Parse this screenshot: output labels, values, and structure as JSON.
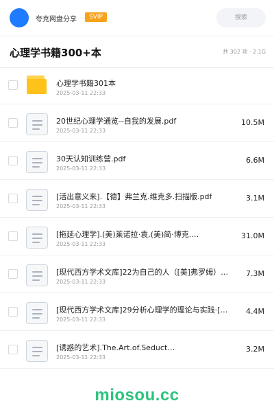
{
  "header": {
    "app_name": "夸克网盘分享",
    "badge": "SVIP",
    "search_label": "搜索"
  },
  "folder": {
    "title": "心理学书籍300+本",
    "meta": "共 302 项 · 2.1G"
  },
  "items": [
    {
      "type": "folder",
      "name": "心理学书籍301本",
      "date": "2025-03-11 22:33",
      "size": ""
    },
    {
      "type": "file",
      "name": "20世纪心理学通览--自我的发展.pdf",
      "date": "2025-03-11 22:33",
      "size": "10.5M"
    },
    {
      "type": "file",
      "name": "30天认知训练营.pdf",
      "date": "2025-03-11 22:33",
      "size": "6.6M"
    },
    {
      "type": "file",
      "name": "[活出意义来].【德】弗兰克.维克多.扫描版.pdf",
      "date": "2025-03-11 22:33",
      "size": "3.1M"
    },
    {
      "type": "file",
      "name": "[拖延心理学].(美)莱诺拉·袁,(美)简·博克.…",
      "date": "2025-03-11 22:33",
      "size": "31.0M"
    },
    {
      "type": "file",
      "name": "[现代西方学术文库]22为自己的人（[美]弗罗姆）…",
      "date": "2025-03-11 22:33",
      "size": "7.3M"
    },
    {
      "type": "file",
      "name": "[现代西方学术文库]29分析心理学的理论与实践·[…",
      "date": "2025-03-11 22:33",
      "size": "4.4M"
    },
    {
      "type": "file",
      "name": "[诱惑的艺术].The.Art.of.Seduct…",
      "date": "2025-03-11 22:33",
      "size": "3.2M"
    }
  ],
  "watermark": "miosou.cc",
  "colors": {
    "accent": "#1f7bff",
    "badge": "#f7a21b",
    "folder": "#ffc21a",
    "watermark": "#2ec27e"
  }
}
